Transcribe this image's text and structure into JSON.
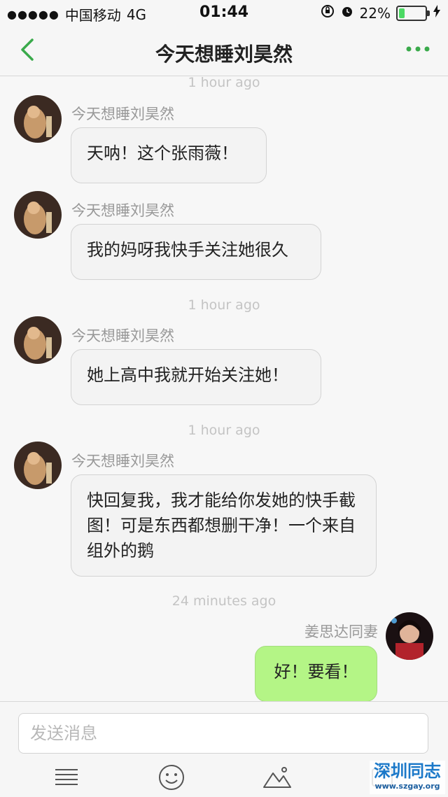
{
  "status_bar": {
    "carrier": "中国移动",
    "network": "4G",
    "time": "01:44",
    "battery": "22%",
    "battery_level": 0.22
  },
  "header": {
    "title": "今天想睡刘昊然"
  },
  "messages": [
    {
      "time": "1 hour ago",
      "sender": "今天想睡刘昊然",
      "text": "天呐！这个张雨薇！"
    },
    {
      "sender": "今天想睡刘昊然",
      "text": "我的妈呀我快手关注她很久"
    },
    {
      "time": "1 hour ago",
      "sender": "今天想睡刘昊然",
      "text": "她上高中我就开始关注她！"
    },
    {
      "time": "1 hour ago",
      "sender": "今天想睡刘昊然",
      "text": "快回复我，我才能给你发她的快手截图！可是东西都想删干净！一个来自组外的鹅"
    },
    {
      "time": "24 minutes ago",
      "sender": "姜思达同妻",
      "text": "好！要看！",
      "mine": true
    }
  ],
  "input": {
    "placeholder": "发送消息"
  },
  "toolbar": {
    "icons": [
      "menu-icon",
      "emoji-icon",
      "image-icon",
      "more-icon"
    ]
  },
  "watermark": {
    "title": "深圳同志",
    "url": "www.szgay.org"
  },
  "colors": {
    "accent": "#3aaa4b",
    "my_bubble": "#b4f586",
    "their_bubble": "#f3f3f3"
  }
}
